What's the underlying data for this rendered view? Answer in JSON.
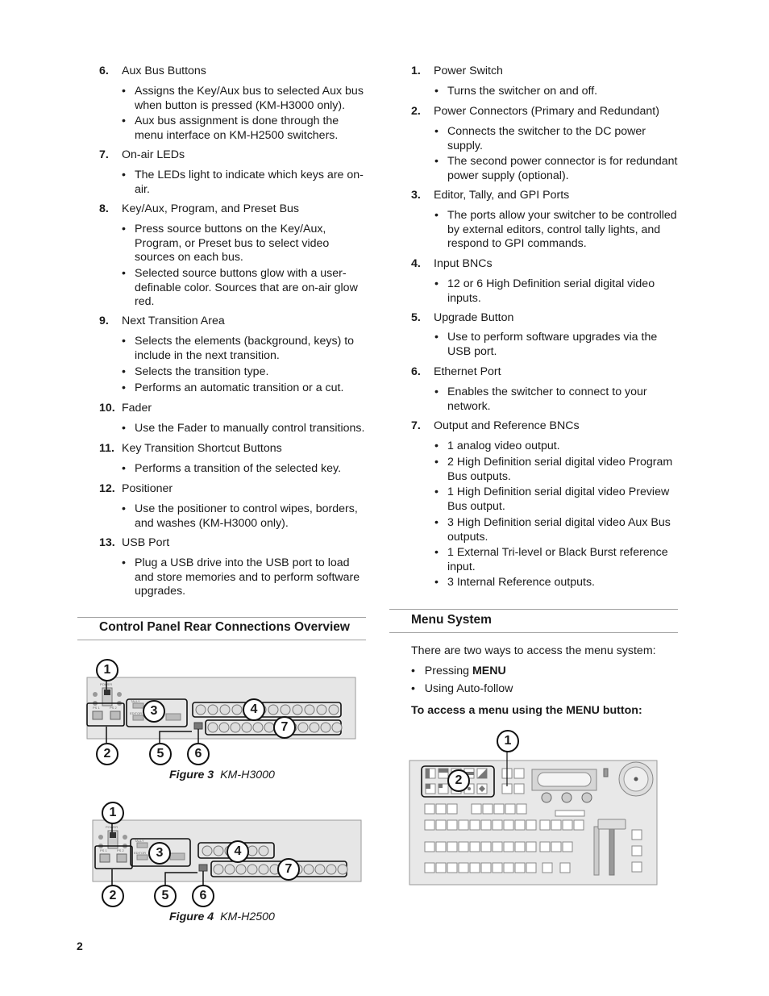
{
  "left_column": {
    "items": [
      {
        "number": "6.",
        "title": "Aux Bus Buttons",
        "bullets": [
          "Assigns the Key/Aux bus to selected Aux bus when button is pressed (KM-H3000 only).",
          "Aux bus assignment is done through the menu interface on KM-H2500 switchers."
        ]
      },
      {
        "number": "7.",
        "title": "On-air LEDs",
        "bullets": [
          "The LEDs light to indicate which keys are on-air."
        ]
      },
      {
        "number": "8.",
        "title": "Key/Aux, Program, and Preset Bus",
        "bullets": [
          "Press source buttons on the Key/Aux, Program, or Preset bus to select video sources on each bus.",
          "Selected source buttons glow with a user-definable color. Sources that are on-air glow red."
        ]
      },
      {
        "number": "9.",
        "title": "Next Transition Area",
        "bullets": [
          "Selects the elements (background, keys) to include in the next transition.",
          "Selects the transition type.",
          "Performs an automatic transition or a cut."
        ]
      },
      {
        "number": "10.",
        "title": "Fader",
        "bullets": [
          "Use the Fader to manually control transitions."
        ]
      },
      {
        "number": "11.",
        "title": "Key Transition Shortcut Buttons",
        "bullets": [
          "Performs a transition of the selected key."
        ]
      },
      {
        "number": "12.",
        "title": "Positioner",
        "bullets": [
          "Use the positioner to control wipes, borders, and washes (KM-H3000 only)."
        ]
      },
      {
        "number": "13.",
        "title": "USB Port",
        "bullets": [
          "Plug a USB drive into the USB port to load and store memories and to perform software upgrades."
        ]
      }
    ],
    "section_heading": "Control Panel Rear Connections Overview",
    "figures": [
      {
        "label": "Figure 3",
        "title": "KM-H3000",
        "callouts": [
          "1",
          "2",
          "3",
          "4",
          "5",
          "6",
          "7"
        ],
        "panel_labels": {
          "power": "POWER",
          "ps1": "PS 1",
          "ps2": "PS 2",
          "tally": "TALLY",
          "editor": "EDITOR"
        }
      },
      {
        "label": "Figure 4",
        "title": "KM-H2500",
        "callouts": [
          "1",
          "2",
          "3",
          "4",
          "5",
          "6",
          "7"
        ],
        "panel_labels": {
          "power": "POWER",
          "ps1": "PS 1",
          "ps2": "PS 2",
          "tally": "TALLY",
          "editor": "EDITOR"
        }
      }
    ]
  },
  "right_column": {
    "items": [
      {
        "number": "1.",
        "title": "Power Switch",
        "bullets": [
          "Turns the switcher on and off."
        ]
      },
      {
        "number": "2.",
        "title": "Power Connectors (Primary and Redundant)",
        "bullets": [
          "Connects the switcher to the DC power supply.",
          "The second power connector is for redundant power supply (optional)."
        ]
      },
      {
        "number": "3.",
        "title": "Editor, Tally, and GPI Ports",
        "bullets": [
          "The ports allow your switcher to be controlled by external editors, control tally lights, and respond to GPI commands."
        ]
      },
      {
        "number": "4.",
        "title": "Input BNCs",
        "bullets": [
          "12 or 6 High Definition serial digital video inputs."
        ]
      },
      {
        "number": "5.",
        "title": "Upgrade Button",
        "bullets": [
          "Use to perform software upgrades via the USB port."
        ]
      },
      {
        "number": "6.",
        "title": "Ethernet Port",
        "bullets": [
          "Enables the switcher to connect to your network."
        ]
      },
      {
        "number": "7.",
        "title": "Output and Reference BNCs",
        "bullets": [
          "1 analog video output.",
          "2 High Definition serial digital video Program Bus outputs.",
          "1 High Definition serial digital video Preview Bus output.",
          "3 High Definition serial digital video Aux Bus outputs.",
          "1 External Tri-level or Black Burst reference input.",
          "3 Internal Reference outputs."
        ]
      }
    ],
    "section_heading": "Menu System",
    "intro": "There are two ways to access the menu system:",
    "access_options": [
      {
        "prefix": "Pressing ",
        "bold": "MENU"
      },
      {
        "prefix": "Using Auto-follow",
        "bold": ""
      }
    ],
    "procedure_heading": "To access a menu using the MENU button:",
    "figure_callouts": [
      "1",
      "2"
    ]
  },
  "page_number": "2",
  "bullet_glyph": "•"
}
